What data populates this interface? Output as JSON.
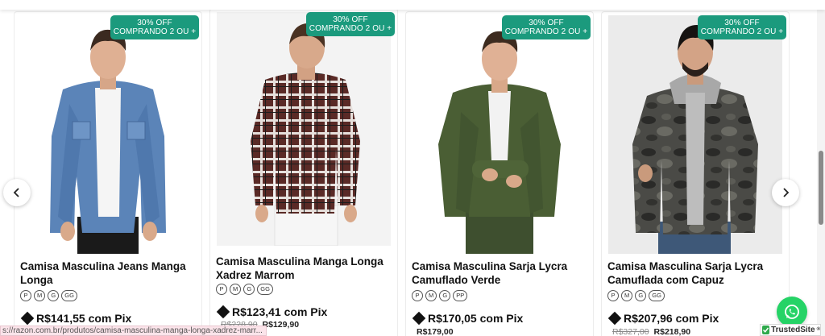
{
  "products": [
    {
      "badge_line1": "30% OFF",
      "badge_line2": "COMPRANDO 2 OU +",
      "title": "Camisa Masculina Jeans Manga Longa",
      "sizes": [
        "P",
        "M",
        "G",
        "GG"
      ],
      "pix_price": "R$141,55 com Pix",
      "old_price": "",
      "price": ""
    },
    {
      "badge_line1": "30% OFF",
      "badge_line2": "COMPRANDO 2 OU +",
      "title": "Camisa Masculina Manga Longa Xadrez Marrom",
      "sizes": [
        "P",
        "M",
        "G",
        "GG"
      ],
      "pix_price": "R$123,41 com Pix",
      "old_price": "R$228,90",
      "price": "R$129,90"
    },
    {
      "badge_line1": "30% OFF",
      "badge_line2": "COMPRANDO 2 OU +",
      "title": "Camisa Masculina Sarja Lycra Camuflado Verde",
      "sizes": [
        "P",
        "M",
        "G",
        "PP"
      ],
      "pix_price": "R$170,05 com Pix",
      "old_price": "",
      "price": "R$179,00"
    },
    {
      "badge_line1": "30% OFF",
      "badge_line2": "COMPRANDO 2 OU +",
      "title": "Camisa Masculina Sarja Lycra Camuflada com Capuz",
      "sizes": [
        "P",
        "M",
        "G",
        "GG"
      ],
      "pix_price": "R$207,96 com Pix",
      "old_price": "R$327,00",
      "price": "R$218,90"
    }
  ],
  "status_bar": {
    "url": "s://razon.com.br/produtos/camisa-masculina-manga-longa-xadrez-marr..."
  },
  "trusted_site": {
    "label": "TrustedSite",
    "mark": "®"
  },
  "icons": {
    "prev": "chevron-left-icon",
    "next": "chevron-right-icon",
    "whatsapp": "whatsapp-icon",
    "pix": "pix-icon"
  },
  "colors": {
    "badge": "#1b9a7d",
    "whatsapp": "#25d366",
    "trusted_check": "#2ea94b"
  }
}
